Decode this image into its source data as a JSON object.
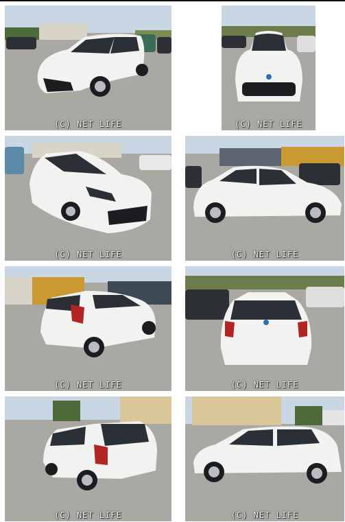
{
  "gallery": {
    "watermark": "(C) NET LIFE",
    "photos": [
      {
        "view": "front-left-three-quarter",
        "watermark": "(C) NET LIFE"
      },
      {
        "view": "front",
        "watermark": "(C) NET LIFE"
      },
      {
        "view": "front-left-three-quarter-close",
        "watermark": "(C) NET LIFE"
      },
      {
        "view": "right-side",
        "watermark": "(C) NET LIFE"
      },
      {
        "view": "rear-left-three-quarter",
        "watermark": "(C) NET LIFE"
      },
      {
        "view": "rear",
        "watermark": "(C) NET LIFE"
      },
      {
        "view": "rear-left-three-quarter-close",
        "watermark": "(C) NET LIFE"
      },
      {
        "view": "left-side",
        "watermark": "(C) NET LIFE"
      }
    ],
    "colors": {
      "car_body": "#f2f2f0",
      "ground": "#a9a8a2",
      "sky": "#c9d6e4",
      "window": "#2b2f36"
    }
  }
}
